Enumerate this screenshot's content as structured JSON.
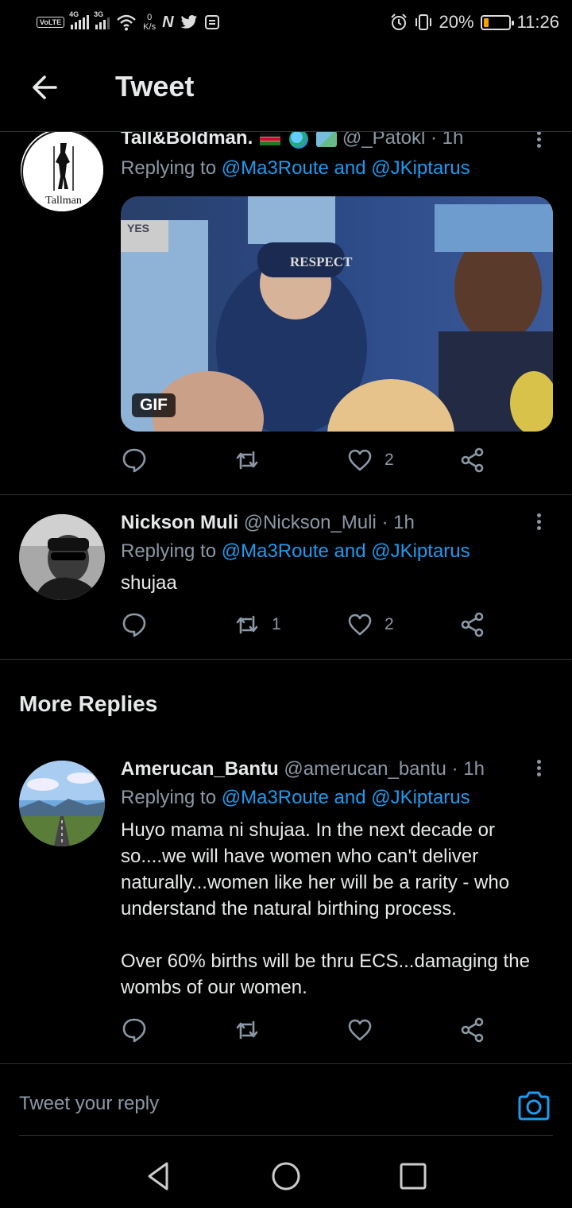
{
  "status_bar": {
    "volte": "VoLTE",
    "net1": "4G",
    "net2": "3G",
    "speed_value": "0",
    "speed_unit": "K/s",
    "app_nyt": "N",
    "battery_percent": "20%",
    "battery_level": 0.2,
    "time": "11:26"
  },
  "header": {
    "title": "Tweet"
  },
  "tweets": [
    {
      "name": "Tall&Boldman.",
      "handle": "@_Patokl",
      "time": "· 1h",
      "replying_prefix": "Replying to",
      "replying_links": "@Ma3Route and @JKiptarus",
      "avatar_text": "Tallman",
      "media_badge": "GIF",
      "media_text": "RESPECT",
      "media_sign": "YES",
      "reply_count": "",
      "retweet_count": "",
      "like_count": "2"
    },
    {
      "name": "Nickson Muli",
      "handle": "@Nickson_Muli",
      "time": "· 1h",
      "replying_prefix": "Replying to",
      "replying_links": "@Ma3Route and @JKiptarus",
      "body": "shujaa",
      "reply_count": "",
      "retweet_count": "1",
      "like_count": "2"
    },
    {
      "name": "Amerucan_Bantu",
      "handle": "@amerucan_bantu",
      "time": "· 1h",
      "replying_prefix": "Replying to",
      "replying_links": "@Ma3Route and @JKiptarus",
      "body_p1": "Huyo mama ni shujaa. In the next decade or so....we will have women who can't deliver naturally...women like her will be a rarity - who understand the natural birthing process.",
      "body_p2": "Over 60% births will be thru ECS...damaging the wombs of our women.",
      "reply_count": "",
      "retweet_count": "",
      "like_count": ""
    }
  ],
  "section": {
    "more_replies": "More Replies"
  },
  "reply_bar": {
    "placeholder": "Tweet your reply"
  },
  "icons": {
    "back": "arrow-left-icon",
    "reply": "comment-icon",
    "retweet": "retweet-icon",
    "like": "heart-icon",
    "share": "share-icon",
    "camera": "camera-icon"
  },
  "colors": {
    "background": "#000000",
    "link": "#1d9bf0",
    "secondary_text": "#8b98a5",
    "primary_text": "#e7e9ea",
    "divider": "#2f3336"
  }
}
